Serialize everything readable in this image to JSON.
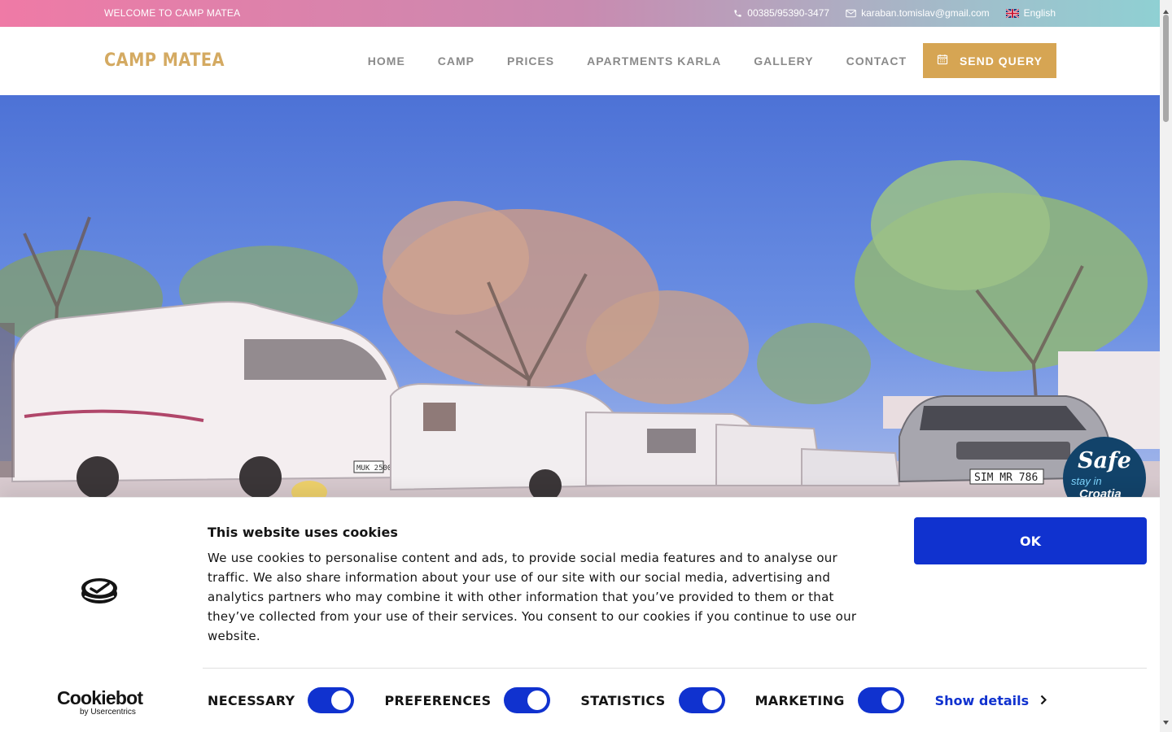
{
  "topbar": {
    "welcome": "WELCOME TO CAMP MATEA",
    "phone": "00385/95390-3477",
    "email": "karaban.tomislav@gmail.com",
    "language": "English"
  },
  "header": {
    "logo": "CAMP MATEA",
    "nav": [
      "HOME",
      "CAMP",
      "PRICES",
      "APARTMENTS KARLA",
      "GALLERY",
      "CONTACT"
    ],
    "query_button": "SEND QUERY"
  },
  "hero": {
    "badge_line1": "Safe",
    "badge_line2": "stay in",
    "badge_line3": "Croatia",
    "plate_front": "SIM MR 786",
    "plate_rv": "MUK 2500"
  },
  "cookie": {
    "title": "This website uses cookies",
    "text": "We use cookies to personalise content and ads, to provide social media features and to analyse our traffic. We also share information about your use of our site with our social media, advertising and analytics partners who may combine it with other information that you’ve provided to them or that they’ve collected from your use of their services. You consent to our cookies if you continue to use our website.",
    "ok_label": "OK",
    "toggles": [
      {
        "label": "NECESSARY",
        "on": true
      },
      {
        "label": "PREFERENCES",
        "on": true
      },
      {
        "label": "STATISTICS",
        "on": true
      },
      {
        "label": "MARKETING",
        "on": true
      }
    ],
    "show_details": "Show details",
    "brand_name": "Cookiebot",
    "brand_by": "by Usercentrics"
  },
  "colors": {
    "logo": "#d4aa62",
    "query_button": "#d6a553",
    "cookie_accent": "#1032cf",
    "badge": "#12436a"
  }
}
